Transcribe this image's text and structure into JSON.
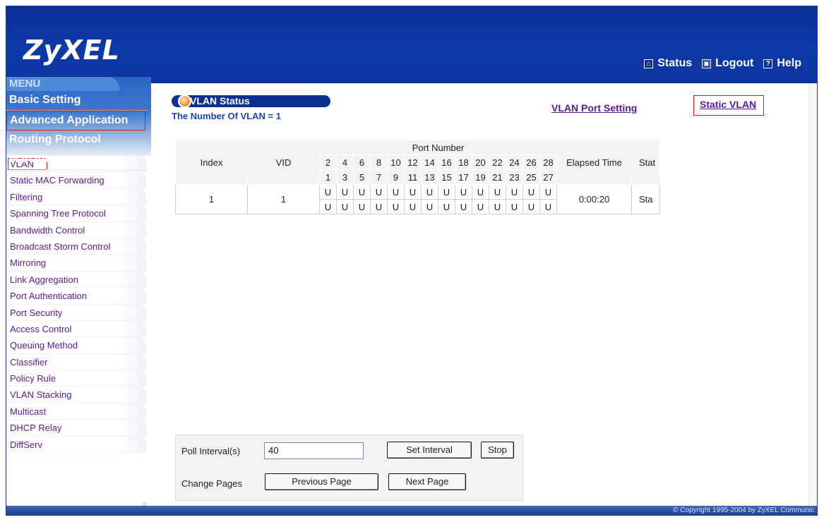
{
  "header": {
    "logo": "ZyXEL",
    "links": [
      {
        "icon": "status-icon",
        "label": "Status"
      },
      {
        "icon": "logout-icon",
        "label": "Logout"
      },
      {
        "icon": "help-icon",
        "label": "Help"
      }
    ]
  },
  "sidebar": {
    "menu_label": "MENU",
    "menu_items": [
      "Basic Setting",
      "Advanced Application",
      "Routing Protocol",
      "Management"
    ],
    "sub_items": [
      "VLAN",
      "Static MAC Forwarding",
      "Filtering",
      "Spanning Tree Protocol",
      "Bandwidth Control",
      "Broadcast Storm Control",
      "Mirroring",
      "Link Aggregation",
      "Port Authentication",
      "Port Security",
      "Access Control",
      "Queuing Method",
      "Classifier",
      "Policy Rule",
      "VLAN Stacking",
      "Multicast",
      "DHCP Relay",
      "DiffServ"
    ]
  },
  "content": {
    "title": "VLAN Status",
    "vlan_count": "The Number Of VLAN = 1",
    "link_port_setting": "VLAN Port Setting",
    "link_static_vlan": "Static VLAN"
  },
  "table": {
    "headers": {
      "index": "Index",
      "vid": "VID",
      "port_number": "Port Number",
      "elapsed": "Elapsed Time",
      "status": "Stat"
    },
    "even_ports": [
      "2",
      "4",
      "6",
      "8",
      "10",
      "12",
      "14",
      "16",
      "18",
      "20",
      "22",
      "24",
      "26",
      "28"
    ],
    "odd_ports": [
      "1",
      "3",
      "5",
      "7",
      "9",
      "11",
      "13",
      "15",
      "17",
      "19",
      "21",
      "23",
      "25",
      "27"
    ],
    "rows": [
      {
        "index": "1",
        "vid": "1",
        "even": [
          "U",
          "U",
          "U",
          "U",
          "U",
          "U",
          "U",
          "U",
          "U",
          "U",
          "U",
          "U",
          "U",
          "U"
        ],
        "odd": [
          "U",
          "U",
          "U",
          "U",
          "U",
          "U",
          "U",
          "U",
          "U",
          "U",
          "U",
          "U",
          "U",
          "U"
        ],
        "elapsed": "0:00:20",
        "status": "Sta"
      }
    ]
  },
  "controls": {
    "poll_label": "Poll Interval(s)",
    "poll_value": "40",
    "set_interval": "Set Interval",
    "stop": "Stop",
    "change_pages": "Change Pages",
    "previous_page": "Previous Page",
    "next_page": "Next Page"
  },
  "footer": {
    "copyright": "© Copyright 1995-2004 by ZyXEL Communic"
  }
}
